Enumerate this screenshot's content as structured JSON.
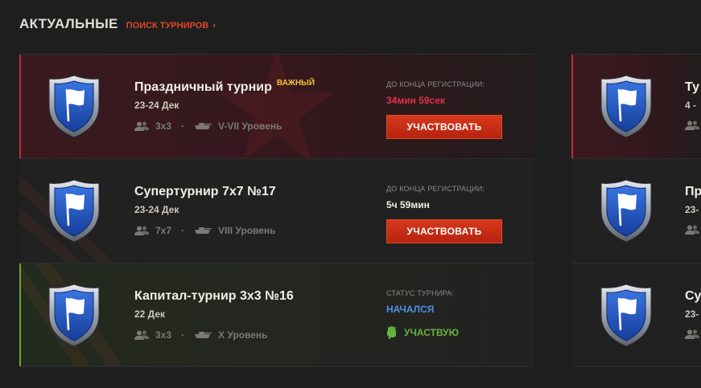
{
  "header": {
    "title": "АКТУАЛЬНЫЕ",
    "link": "ПОИСК ТУРНИРОВ",
    "link_chevron": "›"
  },
  "colors": {
    "accent_red": "#c62a3a",
    "accent_green": "#5fa83a",
    "button": "#c8301a",
    "badge": "#f7c23a",
    "timer_red": "#e0304a",
    "status_blue": "#4f8fe6"
  },
  "tournaments": [
    {
      "title": "Праздничный турнир",
      "badge": "ВАЖНЫЙ",
      "date": "23-24 Дек",
      "format": "3х3",
      "separator": "·",
      "tier": "V-VII Уровень",
      "status_label": "ДО КОНЦА РЕГИСТРАЦИИ:",
      "status_value": "34мин 59сек",
      "action": "УЧАСТВОВАТЬ"
    },
    {
      "title": "Супертурнир 7х7 №17",
      "date": "23-24 Дек",
      "format": "7х7",
      "separator": "·",
      "tier": "VIII Уровень",
      "status_label": "ДО КОНЦА РЕГИСТРАЦИИ:",
      "status_value": "5ч 59мин",
      "action": "УЧАСТВОВАТЬ"
    },
    {
      "title": "Капитал-турнир 3х3 №16",
      "date": "22 Дек",
      "format": "3х3",
      "separator": "·",
      "tier": "Х Уровень",
      "status_label": "СТАТУС ТУРНИРА:",
      "status_value": "НАЧАЛСЯ",
      "joined_label": "УЧАСТВУЮ"
    }
  ],
  "side_cards": [
    {
      "title": "Ту",
      "date": "4 -"
    },
    {
      "title": "Пр",
      "date": "23-"
    },
    {
      "title": "Су",
      "date": "23-"
    }
  ],
  "icons": {
    "emblem": "shield-flag-icon",
    "players": "players-icon",
    "tank": "tank-icon",
    "joined": "fist-icon"
  }
}
